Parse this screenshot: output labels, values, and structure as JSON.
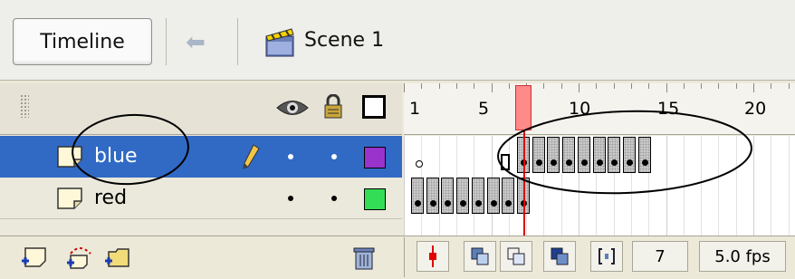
{
  "toolbar": {
    "timeline_label": "Timeline",
    "scene_label": "Scene 1"
  },
  "ruler": {
    "labels": [
      "1",
      "5",
      "10",
      "15",
      "20"
    ]
  },
  "layers": [
    {
      "name": "blue",
      "selected": true,
      "color": "#9933cc",
      "pencil": true
    },
    {
      "name": "red",
      "selected": false,
      "color": "#33dd55",
      "pencil": false
    }
  ],
  "status": {
    "current_frame": "7",
    "frame_rate": "5.0 fps"
  },
  "colors": {
    "selection": "#316ac5",
    "playhead": "#e00000"
  }
}
